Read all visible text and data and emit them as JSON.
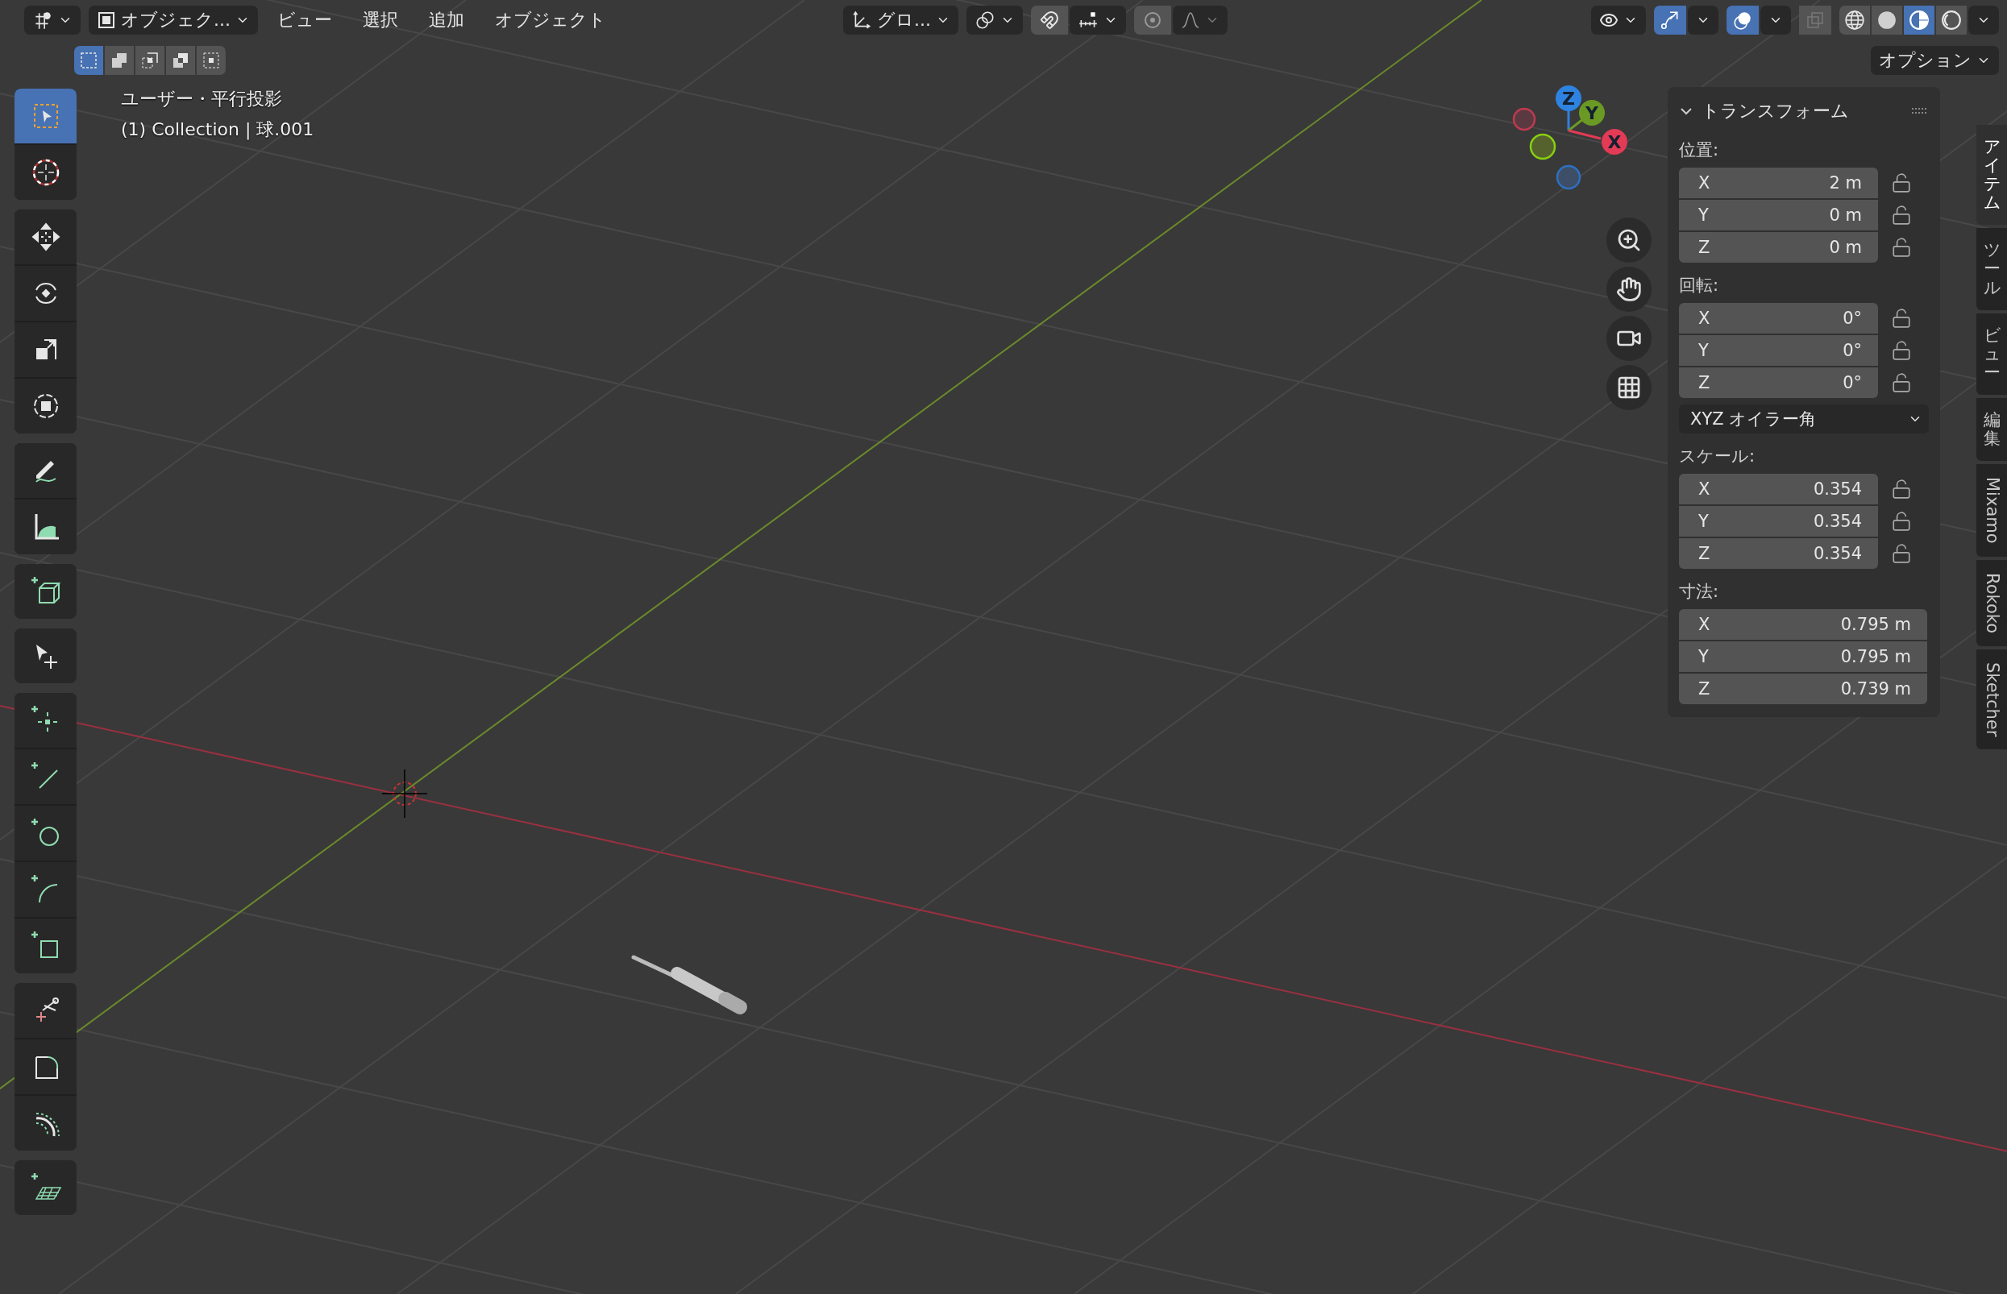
{
  "header": {
    "mode": "オブジェク...",
    "menus": [
      "ビュー",
      "選択",
      "追加",
      "オブジェクト"
    ],
    "orientation": "グロ...",
    "select_modes": [
      {
        "kind": "new",
        "selected": true
      },
      {
        "kind": "extend",
        "selected": false
      },
      {
        "kind": "subtract",
        "selected": false
      },
      {
        "kind": "invert",
        "selected": false
      },
      {
        "kind": "intersect",
        "selected": false
      }
    ],
    "gizmo_toggle": {
      "on": true
    },
    "overlay_toggle": {
      "on": true
    },
    "xray_toggle": {
      "on": false
    },
    "shading_modes": [
      {
        "kind": "wireframe",
        "selected": false
      },
      {
        "kind": "solid",
        "selected": false
      },
      {
        "kind": "material",
        "selected": true
      },
      {
        "kind": "rendered",
        "selected": false
      }
    ],
    "options": "オプション"
  },
  "viewport": {
    "view_name": "ユーザー・平行投影",
    "object_info": "(1) Collection | 球.001"
  },
  "tool_groups": [
    {
      "tools": [
        {
          "kind": "select",
          "selected": true
        },
        {
          "kind": "cursor",
          "selected": false
        }
      ]
    },
    {
      "tools": [
        {
          "kind": "move",
          "selected": false
        },
        {
          "kind": "rotate",
          "selected": false
        },
        {
          "kind": "scale",
          "selected": false
        },
        {
          "kind": "transform",
          "selected": false
        }
      ]
    },
    {
      "tools": [
        {
          "kind": "annotate",
          "selected": false
        },
        {
          "kind": "measure",
          "selected": false
        }
      ]
    },
    {
      "tools": [
        {
          "kind": "add_cube",
          "selected": false
        }
      ]
    },
    {
      "tools": [
        {
          "kind": "select_move",
          "selected": false
        }
      ]
    },
    {
      "tools": [
        {
          "kind": "add_point",
          "selected": false
        },
        {
          "kind": "add_line",
          "selected": false
        },
        {
          "kind": "add_circle",
          "selected": false
        },
        {
          "kind": "add_arc",
          "selected": false
        },
        {
          "kind": "add_rect",
          "selected": false
        }
      ]
    },
    {
      "tools": [
        {
          "kind": "trim",
          "selected": false
        },
        {
          "kind": "fillet",
          "selected": false
        },
        {
          "kind": "offset",
          "selected": false
        }
      ]
    },
    {
      "tools": [
        {
          "kind": "add_grid",
          "selected": false
        }
      ]
    }
  ],
  "gizmo": {
    "axes": [
      {
        "label": "Z",
        "color": "#2e82e0"
      },
      {
        "label": "Y",
        "color": "#6a9a23"
      },
      {
        "label": "X",
        "color": "#e33a55"
      }
    ]
  },
  "panel": {
    "title": "トランスフォーム",
    "expanded": true,
    "location": {
      "label": "位置:",
      "fields": [
        {
          "axis": "X",
          "value": "2 m"
        },
        {
          "axis": "Y",
          "value": "0 m"
        },
        {
          "axis": "Z",
          "value": "0 m"
        }
      ]
    },
    "rotation": {
      "label": "回転:",
      "fields": [
        {
          "axis": "X",
          "value": "0°"
        },
        {
          "axis": "Y",
          "value": "0°"
        },
        {
          "axis": "Z",
          "value": "0°"
        }
      ]
    },
    "rotation_mode": "XYZ オイラー角",
    "scale": {
      "label": "スケール:",
      "fields": [
        {
          "axis": "X",
          "value": "0.354"
        },
        {
          "axis": "Y",
          "value": "0.354"
        },
        {
          "axis": "Z",
          "value": "0.354"
        }
      ]
    },
    "dimensions": {
      "label": "寸法:",
      "fields": [
        {
          "axis": "X",
          "value": "0.795 m"
        },
        {
          "axis": "Y",
          "value": "0.795 m"
        },
        {
          "axis": "Z",
          "value": "0.739 m"
        }
      ]
    }
  },
  "side_tabs": [
    {
      "label": "アイテム",
      "kind": "cjk",
      "selected": true
    },
    {
      "label": "ツール",
      "kind": "cjk",
      "selected": false
    },
    {
      "label": "ビュー",
      "kind": "cjk",
      "selected": false
    },
    {
      "label": "編集",
      "kind": "cjk",
      "selected": false
    },
    {
      "label": "Mixamo",
      "kind": "latin",
      "selected": false
    },
    {
      "label": "Rokoko",
      "kind": "latin",
      "selected": false
    },
    {
      "label": "Sketcher",
      "kind": "latin",
      "selected": false
    }
  ]
}
